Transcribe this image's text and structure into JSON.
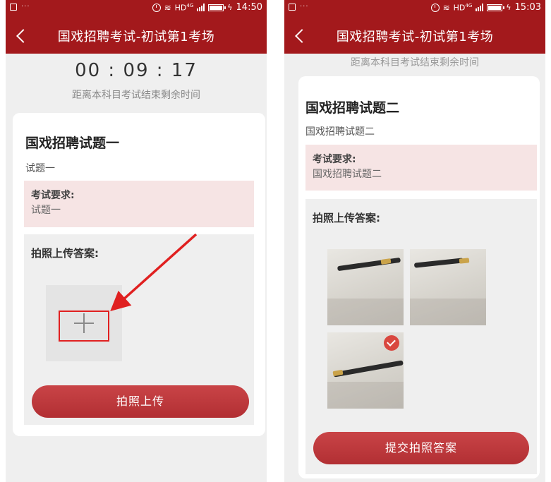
{
  "left_screen": {
    "status_time": "14:50",
    "status_net": "HD",
    "status_net_sup": "4G",
    "nav_title": "国戏招聘考试-初试第1考场",
    "countdown": "00 : 09 : 17",
    "countdown_label": "距离本科目考试结束剩余时间",
    "question_title": "国戏招聘试题一",
    "question_desc": "试题一",
    "req_label": "考试要求:",
    "req_text": "试题一",
    "upload_label": "拍照上传答案:",
    "upload_button": "拍照上传"
  },
  "right_screen": {
    "status_time": "15:03",
    "status_net": "HD",
    "status_net_sup": "4G",
    "nav_title": "国戏招聘考试-初试第1考场",
    "countdown_label": "距离本科目考试结束剩余时间",
    "question_title": "国戏招聘试题二",
    "question_desc": "国戏招聘试题二",
    "req_label": "考试要求:",
    "req_text": "国戏招聘试题二",
    "upload_label": "拍照上传答案:",
    "photos": [
      {
        "name": "answer-photo-1",
        "selected": false
      },
      {
        "name": "answer-photo-2",
        "selected": false
      },
      {
        "name": "answer-photo-3",
        "selected": true
      }
    ],
    "submit_button": "提交拍照答案"
  },
  "colors": {
    "brand_red": "#a3191c",
    "button_red": "#b8363a",
    "request_bg": "#f6e4e4",
    "annotation_red": "#e02020"
  },
  "icons": [
    "sim-icon",
    "clock-icon",
    "wifi-icon",
    "signal-icon",
    "battery-icon",
    "back-icon",
    "plus-icon",
    "check-icon"
  ]
}
